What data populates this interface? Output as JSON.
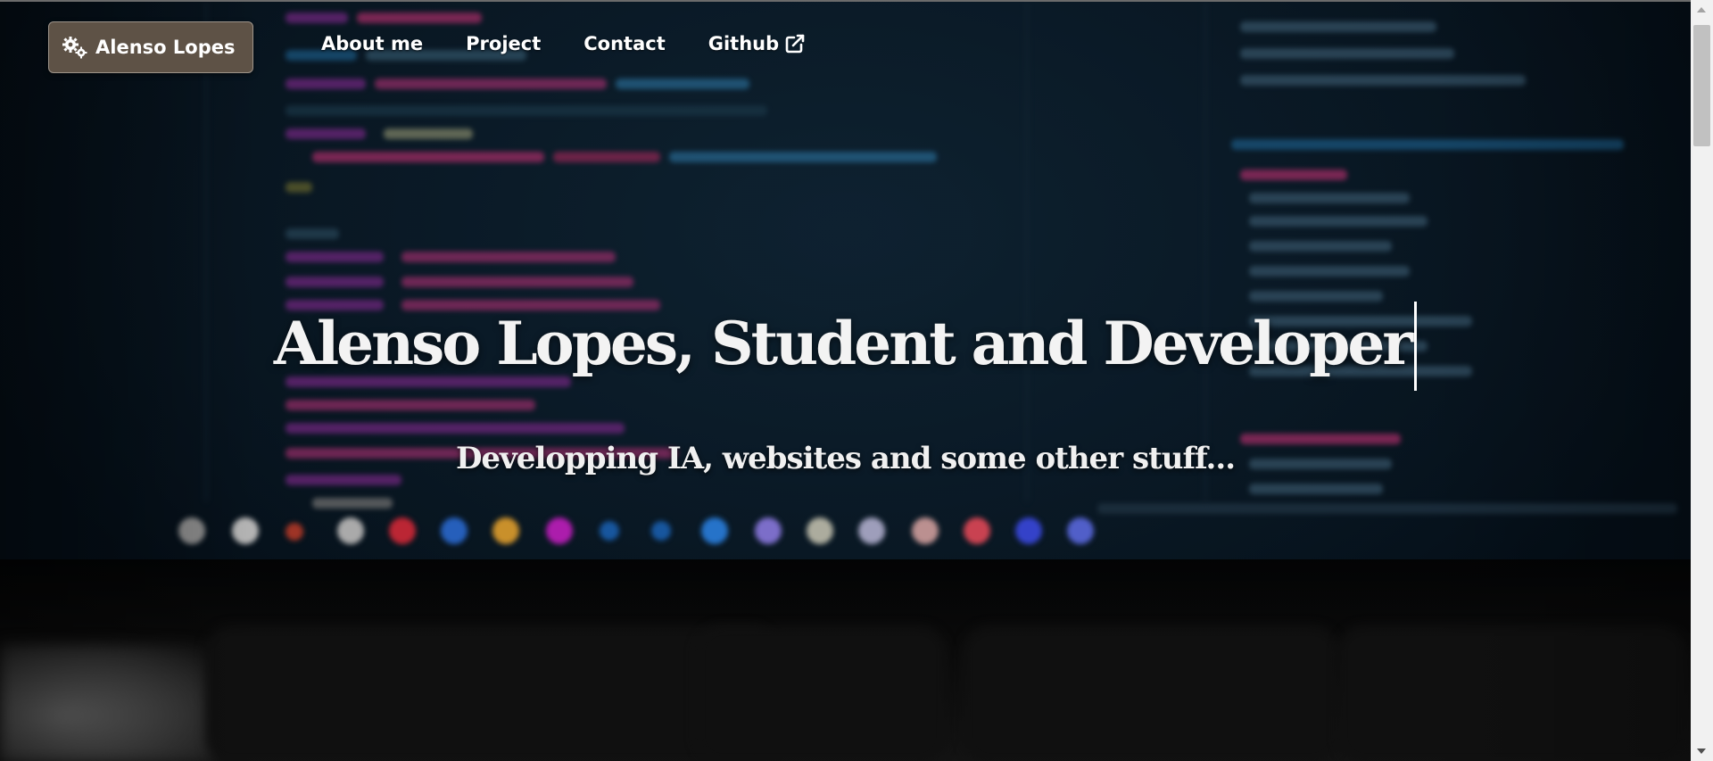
{
  "navbar": {
    "brand": {
      "label": "Alenso Lopes",
      "icon": "gears-icon"
    },
    "links": [
      {
        "label": "About me"
      },
      {
        "label": "Project"
      },
      {
        "label": "Contact"
      },
      {
        "label": "Github",
        "icon": "external-link-icon"
      }
    ]
  },
  "hero": {
    "title": "Alenso Lopes, Student and Developer",
    "subtitle": "Developping IA, websites and some other stuff..."
  },
  "colors": {
    "brand_bg": "#5e5246",
    "brand_border": "#9d948a",
    "text": "#ffffff",
    "background": "#0a1a27"
  }
}
